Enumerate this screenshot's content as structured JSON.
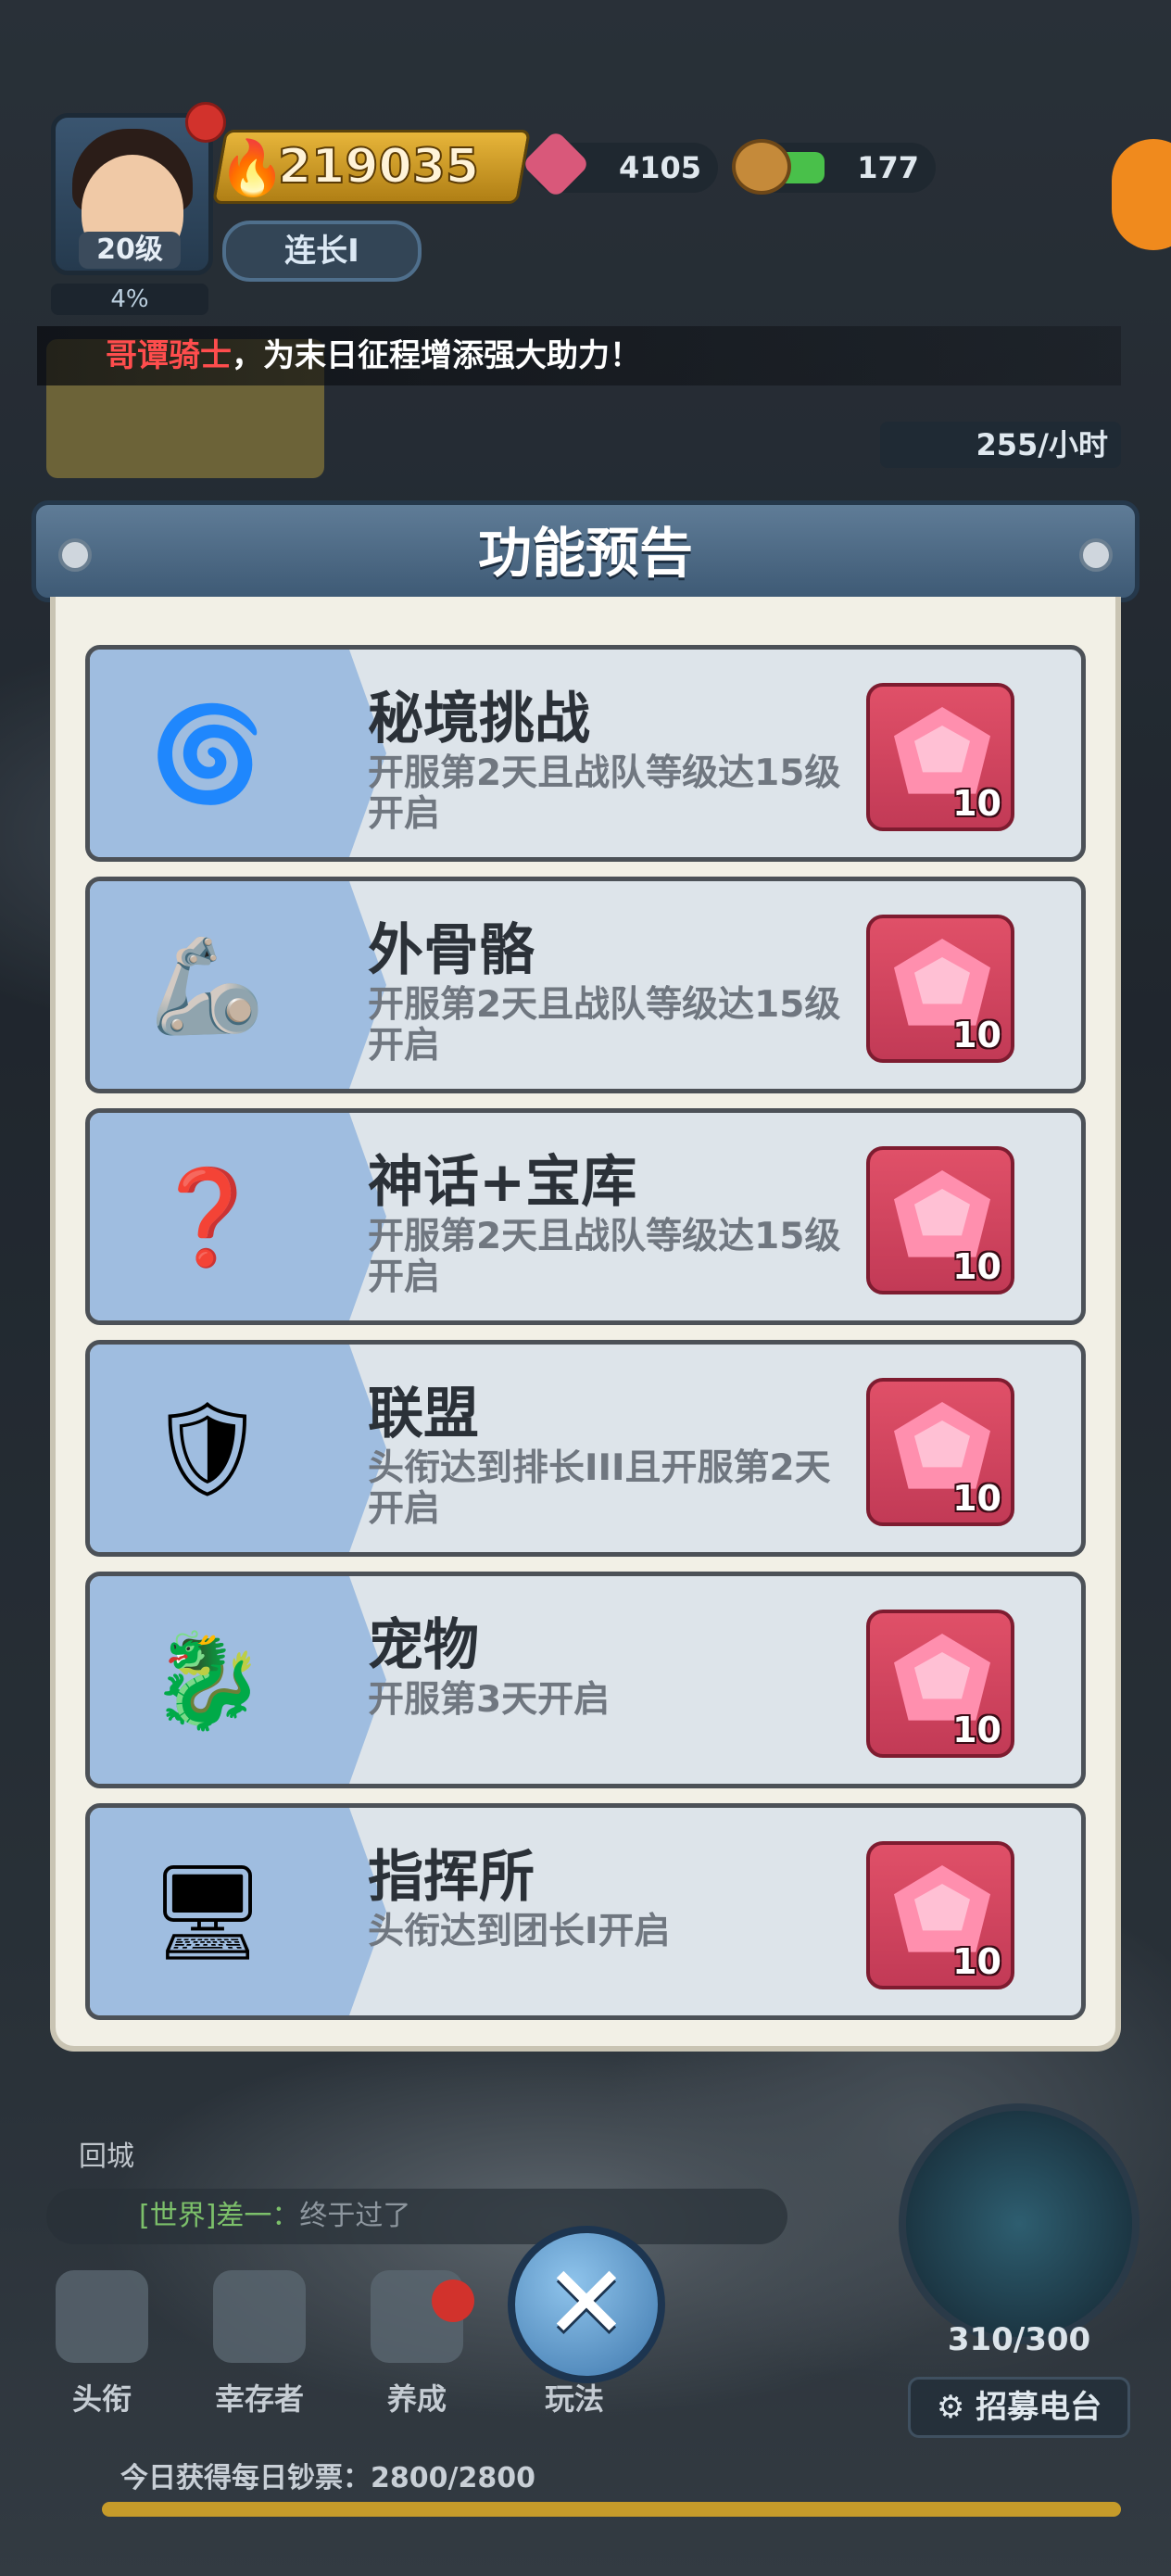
{
  "player": {
    "level": "20级",
    "xp_percent": "4%",
    "power": "219035",
    "rank": "连长I",
    "gems": "4105",
    "wood": "177"
  },
  "notice": {
    "highlight": "哥谭骑士",
    "text": "，为末日征程增添强大助力！"
  },
  "production_rate": "255/小时",
  "dialog": {
    "title": "功能预告",
    "items": [
      {
        "name": "秘境挑战",
        "desc": "开服第2天且战队等级达15级开启",
        "icon": "portal-icon",
        "cost": "10"
      },
      {
        "name": "外骨骼",
        "desc": "开服第2天且战队等级达15级开启",
        "icon": "exoskeleton-icon",
        "cost": "10"
      },
      {
        "name": "神话+宝库",
        "desc": "开服第2天且战队等级达15级开启",
        "icon": "mystery-box-icon",
        "cost": "10"
      },
      {
        "name": "联盟",
        "desc": "头衔达到排长III且开服第2天开启",
        "icon": "alliance-shield-icon",
        "cost": "10"
      },
      {
        "name": "宠物",
        "desc": "开服第3天开启",
        "icon": "pet-dragon-icon",
        "cost": "10"
      },
      {
        "name": "指挥所",
        "desc": "头衔达到团长I开启",
        "icon": "command-post-icon",
        "cost": "10"
      }
    ]
  },
  "recall_label": "回城",
  "chat": {
    "channel": "[世界]",
    "user": "差一：",
    "message": "终于过了"
  },
  "nav": [
    {
      "label": "头衔"
    },
    {
      "label": "幸存者"
    },
    {
      "label": "养成"
    },
    {
      "label": "玩法"
    }
  ],
  "troops": "310/300",
  "recruit_label": "招募电台",
  "daily_reward": "今日获得每日钞票：2800/2800",
  "colors": {
    "accent_header": "#4f6d8a",
    "cost_button": "#d44660",
    "icon_panel": "#9fbde0"
  }
}
